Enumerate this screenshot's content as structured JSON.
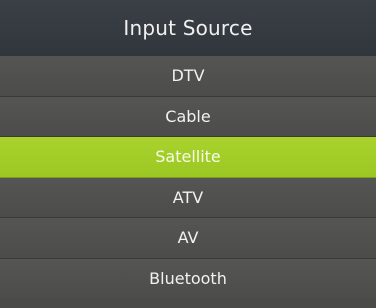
{
  "menu": {
    "title": "Input Source",
    "items": [
      {
        "label": "DTV"
      },
      {
        "label": "Cable"
      },
      {
        "label": "Satellite",
        "selected": true
      },
      {
        "label": "ATV"
      },
      {
        "label": "AV"
      },
      {
        "label": "Bluetooth"
      }
    ],
    "selected_label": "Satellite"
  },
  "colors": {
    "header_background": "#33393f",
    "item_background": "#4f4f4d",
    "selected_background": "#a3cd28",
    "text": "#f2f2f2"
  }
}
